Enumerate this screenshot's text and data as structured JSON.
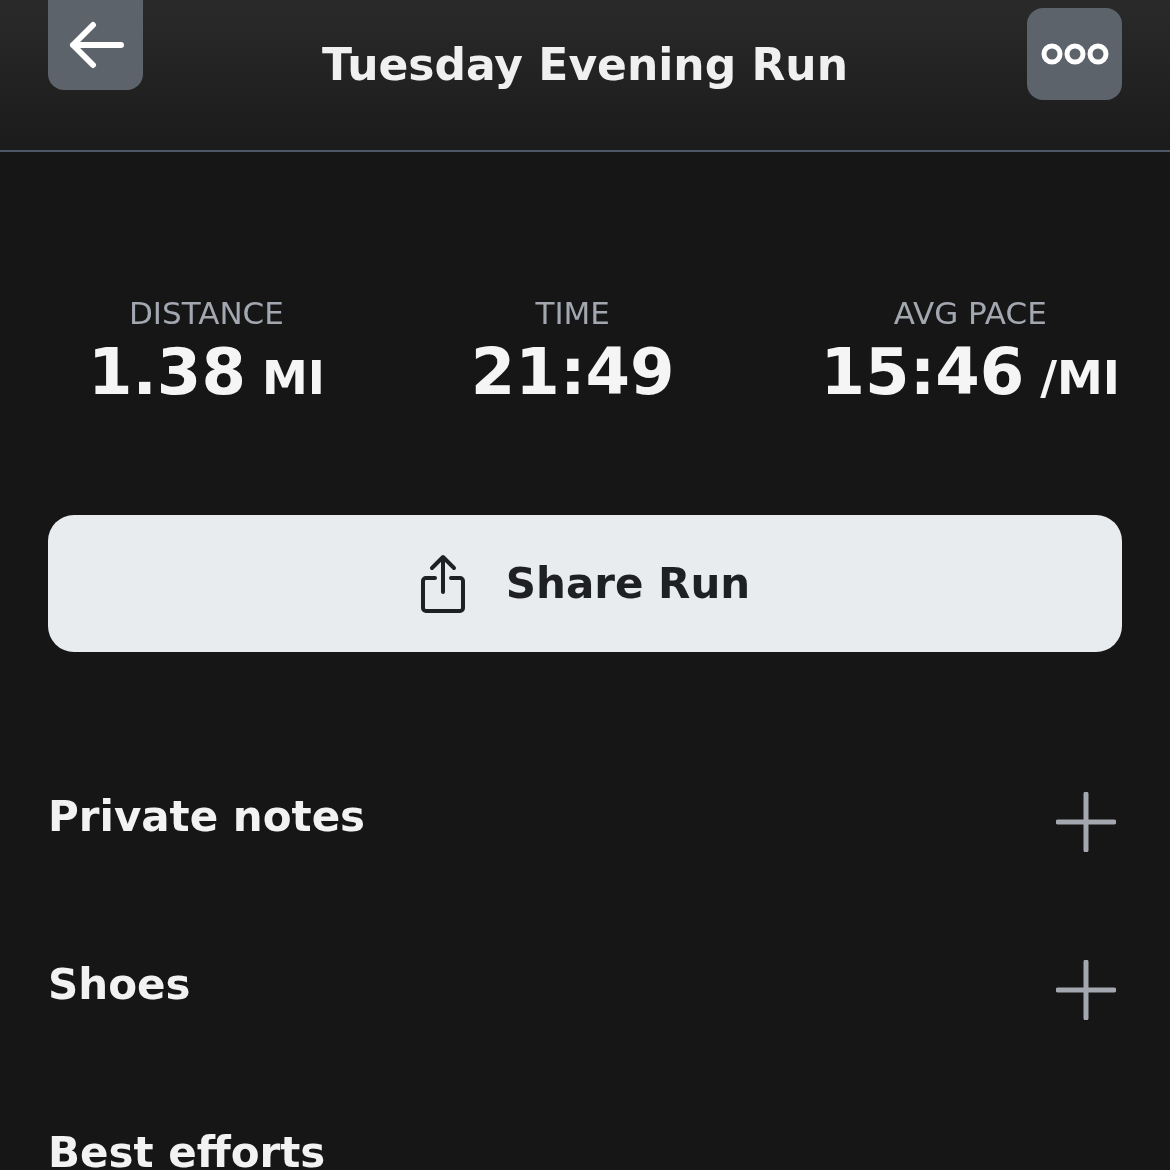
{
  "header": {
    "title": "Tuesday Evening Run"
  },
  "stats": [
    {
      "label": "DISTANCE",
      "value": "1.38",
      "unit": "MI"
    },
    {
      "label": "TIME",
      "value": "21:49"
    },
    {
      "label": "AVG PACE",
      "value": "15:46",
      "unit": "/MI"
    }
  ],
  "share_button": {
    "label": "Share Run"
  },
  "sections": [
    {
      "title": "Private notes",
      "addable": true
    },
    {
      "title": "Shoes",
      "addable": true
    },
    {
      "title": "Best efforts",
      "addable": false
    }
  ]
}
